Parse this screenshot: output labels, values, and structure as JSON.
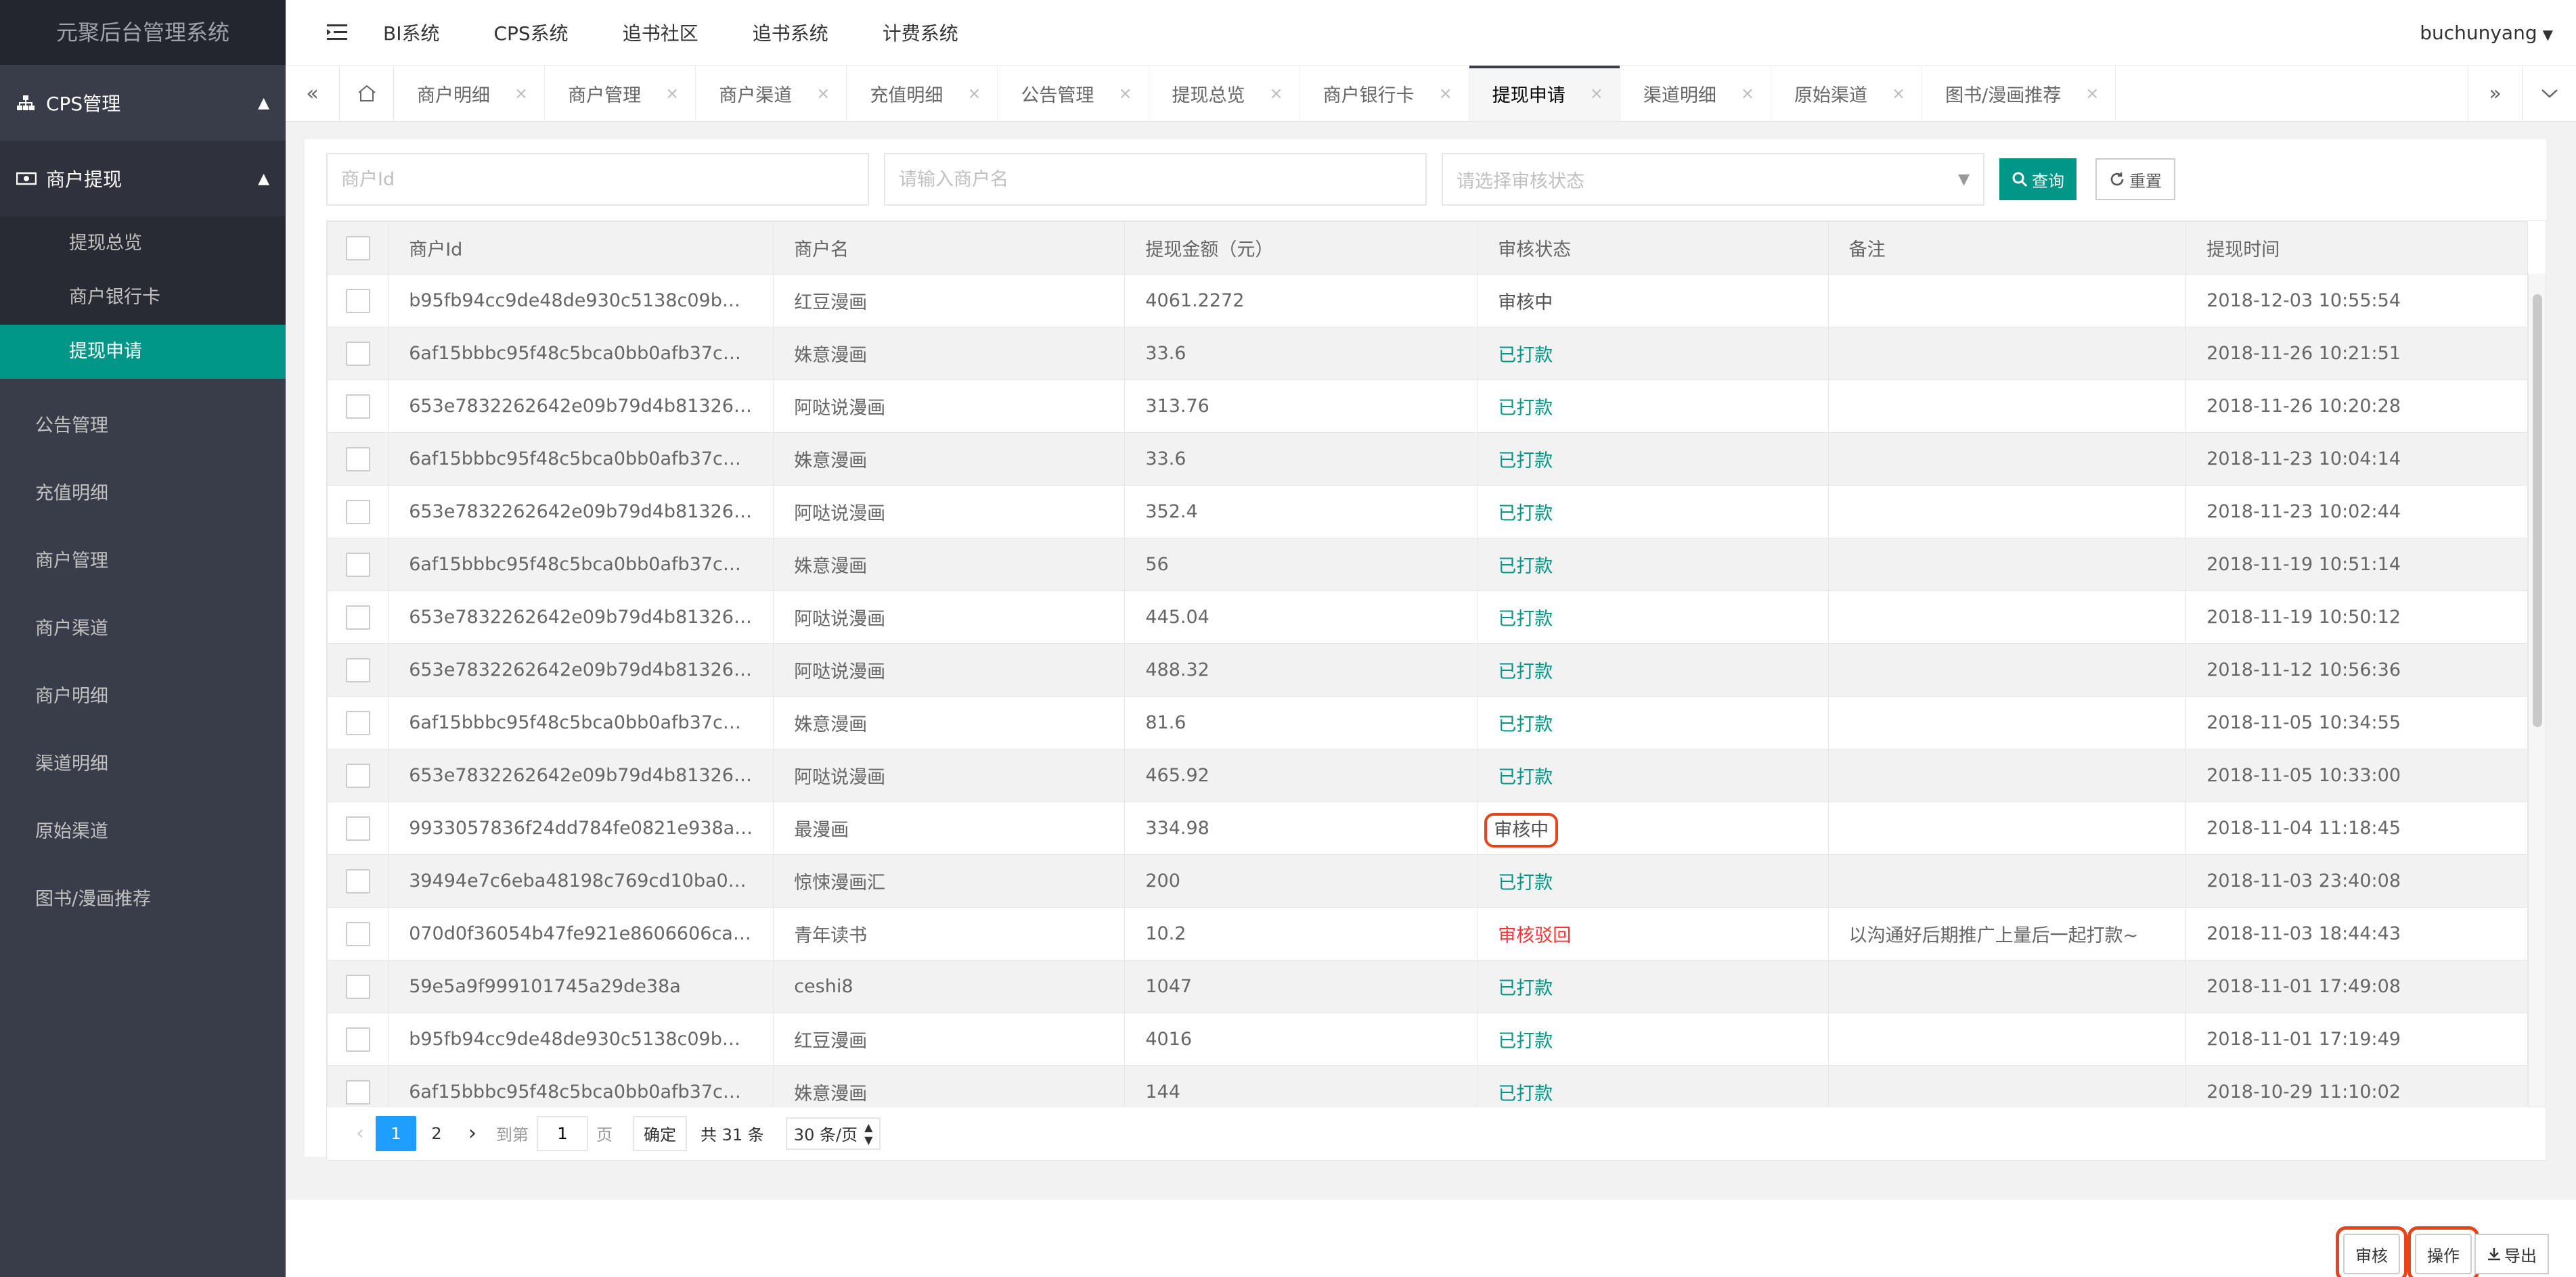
{
  "app": {
    "title": "元聚后台管理系统"
  },
  "sidebar": {
    "group1": {
      "label": "CPS管理",
      "icon": "sitemap-icon"
    },
    "group2": {
      "label": "商户提现",
      "icon": "money-icon",
      "items": [
        {
          "label": "提现总览"
        },
        {
          "label": "商户银行卡"
        },
        {
          "label": "提现申请"
        }
      ]
    },
    "nav": [
      {
        "label": "公告管理"
      },
      {
        "label": "充值明细"
      },
      {
        "label": "商户管理"
      },
      {
        "label": "商户渠道"
      },
      {
        "label": "商户明细"
      },
      {
        "label": "渠道明细"
      },
      {
        "label": "原始渠道"
      },
      {
        "label": "图书/漫画推荐"
      }
    ]
  },
  "header": {
    "menu": [
      {
        "label": "BI系统"
      },
      {
        "label": "CPS系统"
      },
      {
        "label": "追书社区"
      },
      {
        "label": "追书系统"
      },
      {
        "label": "计费系统"
      }
    ],
    "user": "buchunyang"
  },
  "tabs": [
    {
      "label": "商户明细"
    },
    {
      "label": "商户管理"
    },
    {
      "label": "商户渠道"
    },
    {
      "label": "充值明细"
    },
    {
      "label": "公告管理"
    },
    {
      "label": "提现总览"
    },
    {
      "label": "商户银行卡"
    },
    {
      "label": "提现申请"
    },
    {
      "label": "渠道明细"
    },
    {
      "label": "原始渠道"
    },
    {
      "label": "图书/漫画推荐"
    }
  ],
  "filters": {
    "merchant_id_placeholder": "商户Id",
    "merchant_name_placeholder": "请输入商户名",
    "status_placeholder": "请选择审核状态",
    "query_label": "查询",
    "reset_label": "重置"
  },
  "table": {
    "columns": [
      "商户Id",
      "商户名",
      "提现金额（元）",
      "审核状态",
      "备注",
      "提现时间"
    ],
    "rows": [
      {
        "id": "b95fb94cc9de48de930c5138c09b…",
        "name": "红豆漫画",
        "amount": "4061.2272",
        "status": "审核中",
        "status_type": "pending",
        "note": "",
        "time": "2018-12-03 10:55:54"
      },
      {
        "id": "6af15bbbc95f48c5bca0bb0afb37c…",
        "name": "姝意漫画",
        "amount": "33.6",
        "status": "已打款",
        "status_type": "paid",
        "note": "",
        "time": "2018-11-26 10:21:51"
      },
      {
        "id": "653e7832262642e09b79d4b81326…",
        "name": "阿哒说漫画",
        "amount": "313.76",
        "status": "已打款",
        "status_type": "paid",
        "note": "",
        "time": "2018-11-26 10:20:28"
      },
      {
        "id": "6af15bbbc95f48c5bca0bb0afb37c…",
        "name": "姝意漫画",
        "amount": "33.6",
        "status": "已打款",
        "status_type": "paid",
        "note": "",
        "time": "2018-11-23 10:04:14"
      },
      {
        "id": "653e7832262642e09b79d4b81326…",
        "name": "阿哒说漫画",
        "amount": "352.4",
        "status": "已打款",
        "status_type": "paid",
        "note": "",
        "time": "2018-11-23 10:02:44"
      },
      {
        "id": "6af15bbbc95f48c5bca0bb0afb37c…",
        "name": "姝意漫画",
        "amount": "56",
        "status": "已打款",
        "status_type": "paid",
        "note": "",
        "time": "2018-11-19 10:51:14"
      },
      {
        "id": "653e7832262642e09b79d4b81326…",
        "name": "阿哒说漫画",
        "amount": "445.04",
        "status": "已打款",
        "status_type": "paid",
        "note": "",
        "time": "2018-11-19 10:50:12"
      },
      {
        "id": "653e7832262642e09b79d4b81326…",
        "name": "阿哒说漫画",
        "amount": "488.32",
        "status": "已打款",
        "status_type": "paid",
        "note": "",
        "time": "2018-11-12 10:56:36"
      },
      {
        "id": "6af15bbbc95f48c5bca0bb0afb37c…",
        "name": "姝意漫画",
        "amount": "81.6",
        "status": "已打款",
        "status_type": "paid",
        "note": "",
        "time": "2018-11-05 10:34:55"
      },
      {
        "id": "653e7832262642e09b79d4b81326…",
        "name": "阿哒说漫画",
        "amount": "465.92",
        "status": "已打款",
        "status_type": "paid",
        "note": "",
        "time": "2018-11-05 10:33:00"
      },
      {
        "id": "9933057836f24dd784fe0821e938a…",
        "name": "最漫画",
        "amount": "334.98",
        "status": "审核中",
        "status_type": "pending",
        "note": "",
        "time": "2018-11-04 11:18:45",
        "highlight": true
      },
      {
        "id": "39494e7c6eba48198c769cd10ba0…",
        "name": "惊悚漫画汇",
        "amount": "200",
        "status": "已打款",
        "status_type": "paid",
        "note": "",
        "time": "2018-11-03 23:40:08"
      },
      {
        "id": "070d0f36054b47fe921e8606606ca…",
        "name": "青年读书",
        "amount": "10.2",
        "status": "审核驳回",
        "status_type": "reject",
        "note": "以沟通好后期推广上量后一起打款~",
        "time": "2018-11-03 18:44:43"
      },
      {
        "id": "59e5a9f999101745a29de38a",
        "name": "ceshi8",
        "amount": "1047",
        "status": "已打款",
        "status_type": "paid",
        "note": "",
        "time": "2018-11-01 17:49:08"
      },
      {
        "id": "b95fb94cc9de48de930c5138c09b…",
        "name": "红豆漫画",
        "amount": "4016",
        "status": "已打款",
        "status_type": "paid",
        "note": "",
        "time": "2018-11-01 17:19:49"
      },
      {
        "id": "6af15bbbc95f48c5bca0bb0afb37c…",
        "name": "姝意漫画",
        "amount": "144",
        "status": "已打款",
        "status_type": "paid",
        "note": "",
        "time": "2018-10-29 11:10:02"
      }
    ]
  },
  "pager": {
    "pages": [
      "1",
      "2"
    ],
    "current": "1",
    "goto_label": "到第",
    "page_unit": "页",
    "goto_value": "1",
    "confirm_label": "确定",
    "total_label": "共 31 条",
    "page_size_label": "30 条/页"
  },
  "footer": {
    "audit_label": "审核",
    "operate_label": "操作",
    "export_label": "导出"
  },
  "colors": {
    "sidebar_bg": "#393d49",
    "accent": "#009688",
    "paid": "#009688",
    "reject": "#ff3333",
    "highlight": "#e8441c",
    "pager_active": "#1e9fff"
  }
}
